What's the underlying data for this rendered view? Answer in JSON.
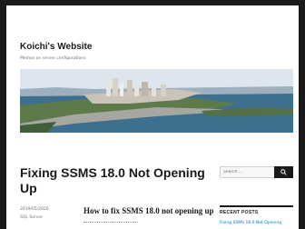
{
  "site": {
    "title": "Koichi's Website",
    "description": "Memos on server configurations"
  },
  "banner": {
    "alt": "city-waterfront-photo",
    "colors": {
      "sky": "#dfe8ef",
      "water": "#3e6f8f",
      "land": "#5f7a4a",
      "buildings": "#c9c3b8",
      "road": "#a7a7a1"
    }
  },
  "post": {
    "title": "Fixing SSMS 18.0 Not Opening Up",
    "date": "2019/05/2020",
    "category": "SQL Server",
    "content_heading": "How to fix SSMS 18.0 not opening up"
  },
  "sidebar": {
    "search_placeholder": "Search …",
    "search_icon": "magnifier-icon",
    "recent_title": "RECENT POSTS",
    "recent_items": [
      "Fixing SSMS 18.0 Not Opening"
    ]
  },
  "colors": {
    "page_bg": "#ffffff",
    "outer_bg": "#1a1a1a",
    "link": "#007acc",
    "text": "#1a1a1a",
    "muted": "#707070"
  }
}
